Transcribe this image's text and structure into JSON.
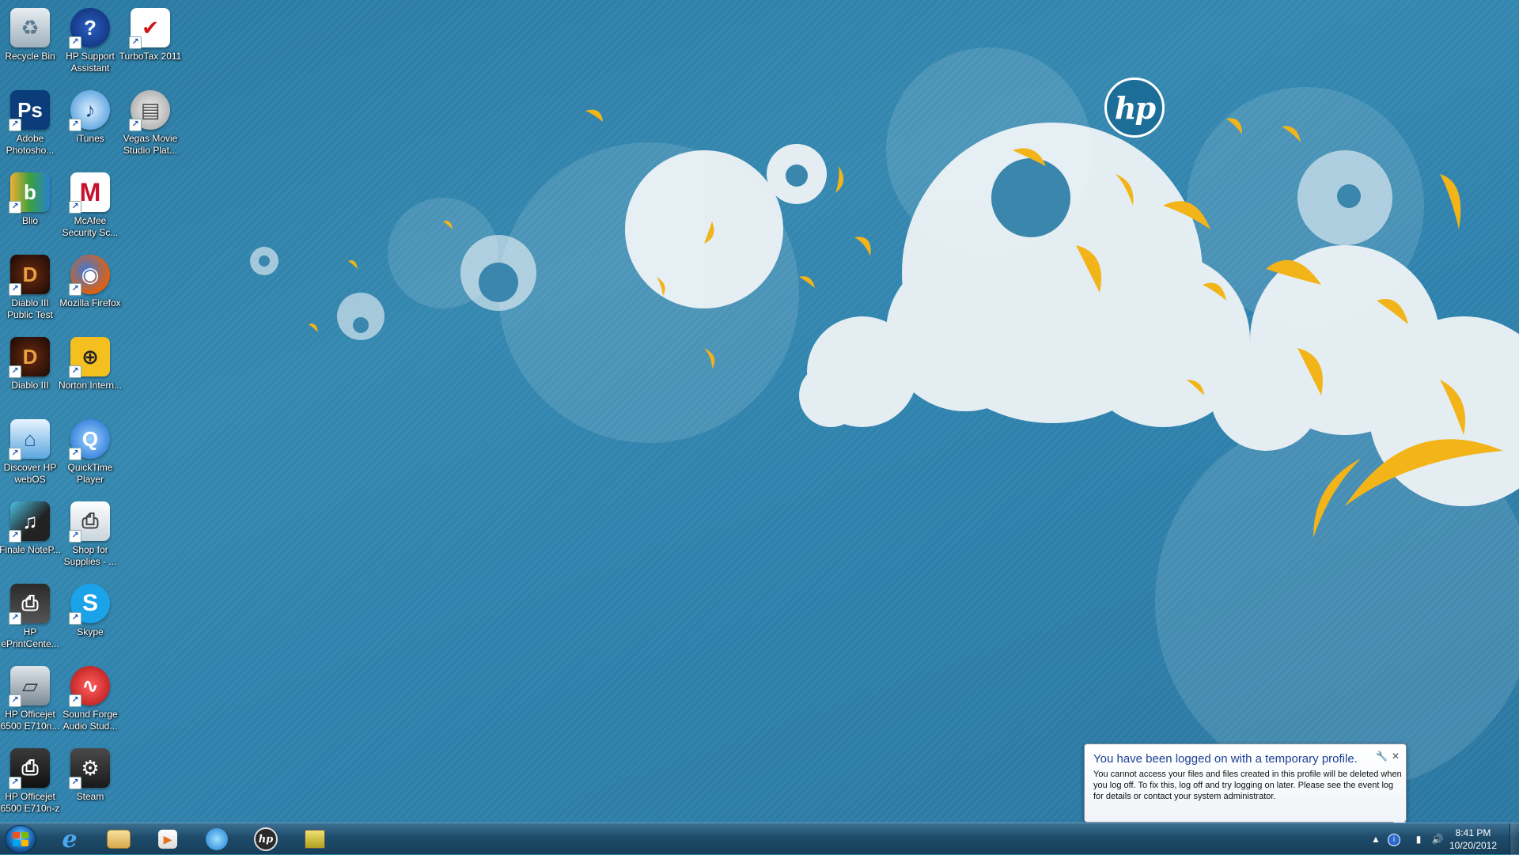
{
  "desktop": {
    "icons": [
      {
        "label": "Recycle Bin",
        "icon": "recycle-bin-icon"
      },
      {
        "label": "HP Support Assistant",
        "icon": "help-icon"
      },
      {
        "label": "TurboTax 2011",
        "icon": "turbotax-icon"
      },
      {
        "label": "Adobe Photosho...",
        "icon": "photoshop-icon"
      },
      {
        "label": "iTunes",
        "icon": "itunes-icon"
      },
      {
        "label": "Vegas Movie Studio Plat...",
        "icon": "vegas-icon"
      },
      {
        "label": "Blio",
        "icon": "blio-icon"
      },
      {
        "label": "McAfee Security Sc...",
        "icon": "mcafee-icon"
      },
      {
        "label": "Diablo III Public Test",
        "icon": "diablo-icon"
      },
      {
        "label": "Mozilla Firefox",
        "icon": "firefox-icon"
      },
      {
        "label": "Diablo III",
        "icon": "diablo-icon"
      },
      {
        "label": "Norton Intern...",
        "icon": "norton-icon"
      },
      {
        "label": "Discover HP webOS",
        "icon": "webos-icon"
      },
      {
        "label": "QuickTime Player",
        "icon": "quicktime-icon"
      },
      {
        "label": "Finale NoteP...",
        "icon": "finale-icon"
      },
      {
        "label": "Shop for Supplies - ...",
        "icon": "printer-supplies-icon"
      },
      {
        "label": "HP ePrintCente...",
        "icon": "hp-eprint-icon"
      },
      {
        "label": "Skype",
        "icon": "skype-icon"
      },
      {
        "label": "HP Officejet 6500 E710n...",
        "icon": "scanner-icon"
      },
      {
        "label": "Sound Forge Audio Stud...",
        "icon": "sound-forge-icon"
      },
      {
        "label": "HP Officejet 6500 E710n-z",
        "icon": "printer-icon"
      },
      {
        "label": "Steam",
        "icon": "steam-icon"
      }
    ]
  },
  "wallpaper": {
    "logo_text": "hp"
  },
  "notification": {
    "title": "You have been logged on with a temporary profile.",
    "body": "You cannot access your files and files created in this profile will be deleted when you log off. To fix this, log off and try logging on later. Please see the event log for details or contact your system administrator.",
    "options_icon": "wrench-icon",
    "close_glyph": "✕"
  },
  "taskbar": {
    "pinned": [
      {
        "name": "internet-explorer",
        "icon": "internet-explorer-icon",
        "glyph": "e"
      },
      {
        "name": "windows-explorer",
        "icon": "folder-icon",
        "glyph": ""
      },
      {
        "name": "media-player",
        "icon": "media-player-icon",
        "glyph": "▶"
      },
      {
        "name": "windows-live",
        "icon": "globe-icon",
        "glyph": ""
      },
      {
        "name": "hp-app",
        "icon": "hp-icon",
        "glyph": "hp"
      },
      {
        "name": "app-window",
        "icon": "app-window-icon",
        "glyph": ""
      }
    ],
    "clock": {
      "time": "8:41 PM",
      "date": "10/20/2012"
    }
  },
  "colors": {
    "accent": "#2f7ea6",
    "balloon_title": "#1b3f94",
    "petal_yellow": "#f2b418"
  }
}
